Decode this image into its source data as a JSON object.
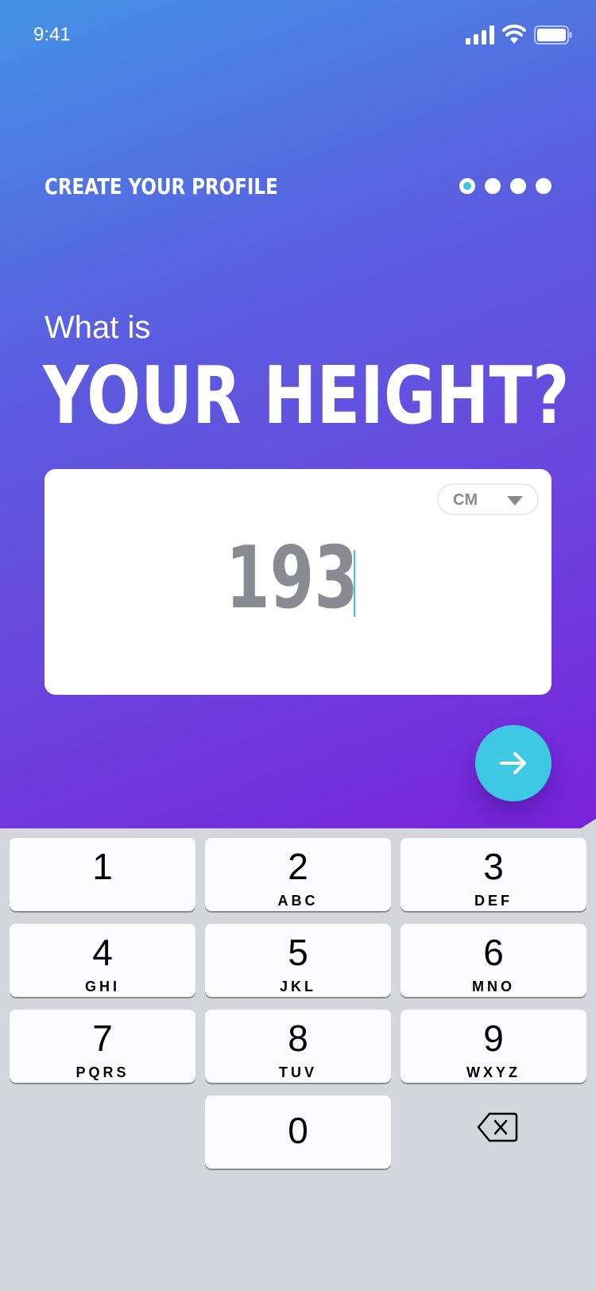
{
  "status_bar": {
    "time": "9:41"
  },
  "header": {
    "title": "CREATE YOUR PROFILE",
    "step_count": 4,
    "current_step": 1
  },
  "question": {
    "pre": "What is",
    "main": "YOUR HEIGHT?"
  },
  "input": {
    "value": "193",
    "unit": "CM"
  },
  "keyboard": {
    "keys": [
      {
        "num": "1",
        "letters": ""
      },
      {
        "num": "2",
        "letters": "ABC"
      },
      {
        "num": "3",
        "letters": "DEF"
      },
      {
        "num": "4",
        "letters": "GHI"
      },
      {
        "num": "5",
        "letters": "JKL"
      },
      {
        "num": "6",
        "letters": "MNO"
      },
      {
        "num": "7",
        "letters": "PQRS"
      },
      {
        "num": "8",
        "letters": "TUV"
      },
      {
        "num": "9",
        "letters": "WXYZ"
      },
      {
        "num": "0",
        "letters": ""
      }
    ]
  },
  "colors": {
    "gradient_start": "#4492e6",
    "gradient_end": "#7a22db",
    "accent": "#3ec8e3",
    "value_text": "#8a8b92"
  },
  "icons": [
    "cellular-signal-icon",
    "wifi-icon",
    "battery-icon",
    "chevron-down-icon",
    "arrow-right-icon",
    "backspace-icon"
  ]
}
